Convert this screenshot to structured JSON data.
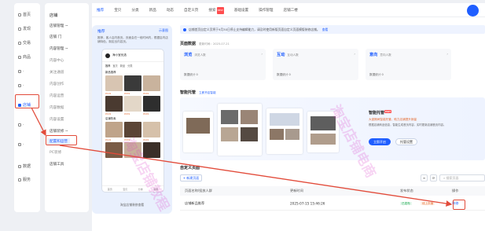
{
  "nav": {
    "items": [
      {
        "label": "首页",
        "active": false
      },
      {
        "label": "发现",
        "active": false
      },
      {
        "label": "交易",
        "active": false
      },
      {
        "label": "商品",
        "active": false
      },
      {
        "label": "·",
        "active": false
      },
      {
        "label": "·",
        "active": false
      },
      {
        "label": "店铺",
        "active": true
      },
      {
        "label": "·",
        "active": false
      },
      {
        "label": "·",
        "active": false
      },
      {
        "label": "数据",
        "active": false
      },
      {
        "label": "服务",
        "active": false
      }
    ]
  },
  "submenu": {
    "items": [
      {
        "label": "店铺",
        "kind": "header"
      },
      {
        "label": "店铺管理 ~",
        "kind": "item"
      },
      {
        "label": "店铺 门",
        "kind": "item"
      },
      {
        "label": "内容管理 ~",
        "kind": "item"
      },
      {
        "label": "内容中心",
        "kind": "muted"
      },
      {
        "label": "关注通道",
        "kind": "muted"
      },
      {
        "label": "内容创作",
        "kind": "muted"
      },
      {
        "label": "内容运营",
        "kind": "muted"
      },
      {
        "label": "内容数据",
        "kind": "muted"
      },
      {
        "label": "内容设置",
        "kind": "muted"
      },
      {
        "label": "店铺装修 ~",
        "kind": "item"
      },
      {
        "label": "配置和运营",
        "kind": "sel"
      },
      {
        "label": "PC装修",
        "kind": "muted"
      },
      {
        "label": "店铺工具",
        "kind": "item"
      }
    ]
  },
  "tabs": [
    {
      "label": "推荐",
      "active": true,
      "badge": ""
    },
    {
      "label": "宝贝",
      "active": false,
      "badge": ""
    },
    {
      "label": "分类",
      "active": false,
      "badge": ""
    },
    {
      "label": "新品",
      "active": false,
      "badge": ""
    },
    {
      "label": "动态",
      "active": false,
      "badge": ""
    },
    {
      "label": "自定义页",
      "active": false,
      "badge": ""
    },
    {
      "label": "搜索",
      "active": false,
      "badge": "NEW"
    },
    {
      "label": "基础设置",
      "active": false,
      "badge": ""
    },
    {
      "label": "操作管理",
      "active": false,
      "badge": ""
    },
    {
      "label": "店铺二楼",
      "active": false,
      "badge": ""
    }
  ],
  "phone": {
    "hint_title": "推荐",
    "hint_link": "示意图",
    "hint_text": "推荐，客人店内首页。页面会在一段时间内，根据店内店铺特色，制定出内容页。",
    "store_name": "海小宝优选",
    "screen_tabs": [
      "推荐",
      "宝贝",
      "新品",
      "分类"
    ],
    "section_1": "新品推荐",
    "section_2": "店铺热卖",
    "price_1": "¥119",
    "price_2": "¥159",
    "price_3": "¥129",
    "foot_tabs": [
      "首页",
      "宝贝",
      "分类",
      "客服"
    ],
    "footer": "淘宝店铺装修查看"
  },
  "notice": {
    "text": "店铺首页自定义页将于9月30日停止支持编辑能力，请及时使用新版页面自定义页面模版装修店铺。",
    "link": "查看"
  },
  "page_data_section": {
    "title": "页面数据",
    "subtitle": "更新时间：2025-07-21",
    "cards": [
      {
        "label": "浏览",
        "sub": "浏览人数",
        "value": "数据统计 0"
      },
      {
        "label": "互动",
        "sub": "互动人数",
        "value": "数据统计 0"
      },
      {
        "label": "意向",
        "sub": "意向人数",
        "value": "数据统计 0"
      }
    ]
  },
  "trustee": {
    "title": "智能托管",
    "subtitle": "立即开启智能",
    "panel_title": "智能托管",
    "panel_badge": "HOT",
    "panel_desc1": "大促期间智能托管，助力店铺提升销量",
    "panel_desc2": "根据店铺商品信息，智能生成首页内容，实时更新店铺首页内容。",
    "btn_primary": "立即开启",
    "btn_secondary": "托管设置"
  },
  "custom_section": {
    "title": "自定义页面",
    "create_btn": "+ 新建页面",
    "search_placeholder": "搜索页面",
    "columns": [
      "页面名称/投放人群",
      "更新时间",
      "发布状态",
      "操作"
    ],
    "row": {
      "name": "店铺新品推荐",
      "time": "2025-07-15 15:46:26",
      "status_a": "已发布",
      "status_b": "线上页面",
      "op": "装修"
    }
  },
  "watermark": {
    "text_1": "淘宝店铺教程",
    "text_2": "淘宝店铺电商"
  }
}
